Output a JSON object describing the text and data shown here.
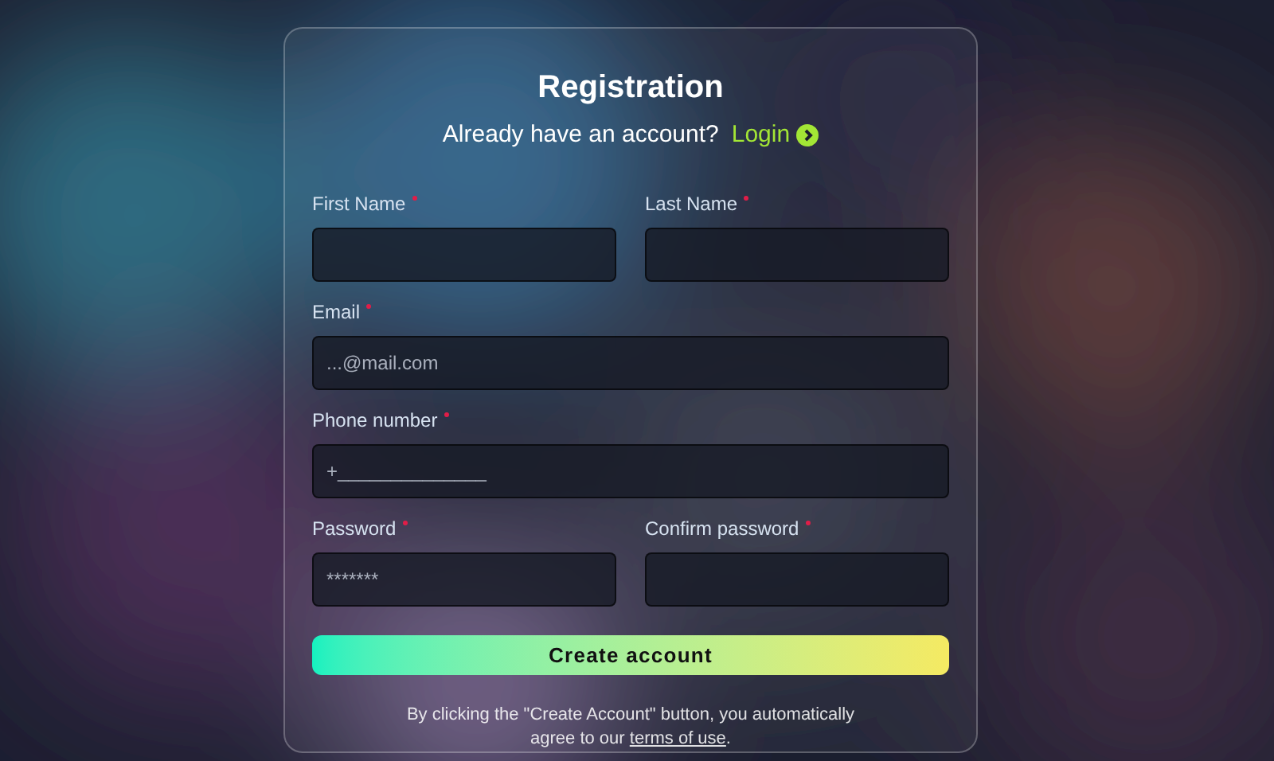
{
  "title": "Registration",
  "login_prompt": {
    "text": "Already have an account?",
    "link": "Login"
  },
  "rows": [
    [
      {
        "label": "First Name",
        "required": true
      },
      {
        "label": "Last Name",
        "required": true
      }
    ],
    [
      {
        "label": "Email",
        "required": true,
        "placeholder": "...@mail.com"
      }
    ],
    [
      {
        "label": "Phone number",
        "required": true,
        "placeholder": "+______________"
      }
    ],
    [
      {
        "label": "Password",
        "required": true,
        "placeholder": "*******"
      },
      {
        "label": "Confirm password",
        "required": true
      }
    ]
  ],
  "submit": "Create account",
  "notice": {
    "text": "By clicking the \"Create Account\" button, you automatically agree to our ",
    "link": "terms of use",
    "end": "."
  }
}
